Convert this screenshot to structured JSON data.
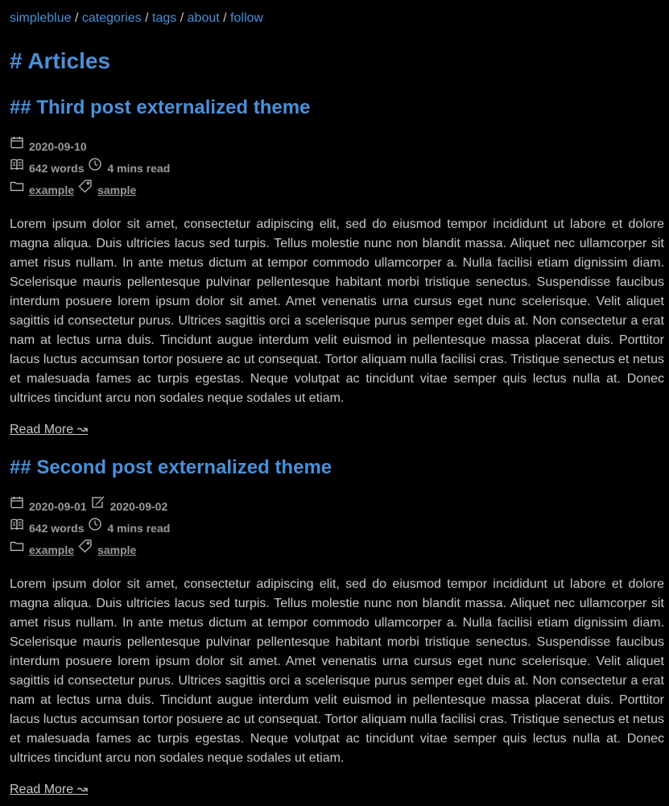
{
  "nav": {
    "items": [
      "simpleblue",
      "categories",
      "tags",
      "about",
      "follow"
    ],
    "separator": "/"
  },
  "page_title": "# Articles",
  "posts": [
    {
      "title": "## Third post externalized theme",
      "date": "2020-09-10",
      "updated": "",
      "words": "642 words",
      "read_time": "4 mins read",
      "category": "example",
      "tag": "sample",
      "excerpt": "Lorem ipsum dolor sit amet, consectetur adipiscing elit, sed do eiusmod tempor incididunt ut labore et dolore magna aliqua. Duis ultricies lacus sed turpis. Tellus molestie nunc non blandit massa. Aliquet nec ullamcorper sit amet risus nullam. In ante metus dictum at tempor commodo ullamcorper a. Nulla facilisi etiam dignissim diam. Scelerisque mauris pellentesque pulvinar pellentesque habitant morbi tristique senectus. Suspendisse faucibus interdum posuere lorem ipsum dolor sit amet. Amet venenatis urna cursus eget nunc scelerisque. Velit aliquet sagittis id consectetur purus. Ultrices sagittis orci a scelerisque purus semper eget duis at. Non consectetur a erat nam at lectus urna duis. Tincidunt augue interdum velit euismod in pellentesque massa placerat duis. Porttitor lacus luctus accumsan tortor posuere ac ut consequat. Tortor aliquam nulla facilisi cras. Tristique senectus et netus et malesuada fames ac turpis egestas. Neque volutpat ac tincidunt vitae semper quis lectus nulla at. Donec ultrices tincidunt arcu non sodales neque sodales ut etiam.",
      "read_more": "Read More ↝"
    },
    {
      "title": "## Second post externalized theme",
      "date": "2020-09-01",
      "updated": "2020-09-02",
      "words": "642 words",
      "read_time": "4 mins read",
      "category": "example",
      "tag": "sample",
      "excerpt": "Lorem ipsum dolor sit amet, consectetur adipiscing elit, sed do eiusmod tempor incididunt ut labore et dolore magna aliqua. Duis ultricies lacus sed turpis. Tellus molestie nunc non blandit massa. Aliquet nec ullamcorper sit amet risus nullam. In ante metus dictum at tempor commodo ullamcorper a. Nulla facilisi etiam dignissim diam. Scelerisque mauris pellentesque pulvinar pellentesque habitant morbi tristique senectus. Suspendisse faucibus interdum posuere lorem ipsum dolor sit amet. Amet venenatis urna cursus eget nunc scelerisque. Velit aliquet sagittis id consectetur purus. Ultrices sagittis orci a scelerisque purus semper eget duis at. Non consectetur a erat nam at lectus urna duis. Tincidunt augue interdum velit euismod in pellentesque massa placerat duis. Porttitor lacus luctus accumsan tortor posuere ac ut consequat. Tortor aliquam nulla facilisi cras. Tristique senectus et netus et malesuada fames ac turpis egestas. Neque volutpat ac tincidunt vitae semper quis lectus nulla at. Donec ultrices tincidunt arcu non sodales neque sodales ut etiam.",
      "read_more": "Read More ↝"
    }
  ],
  "colors": {
    "background": "#000000",
    "accent": "#4a90d9",
    "text": "#c8c8c8",
    "meta": "#9a9a9a"
  }
}
